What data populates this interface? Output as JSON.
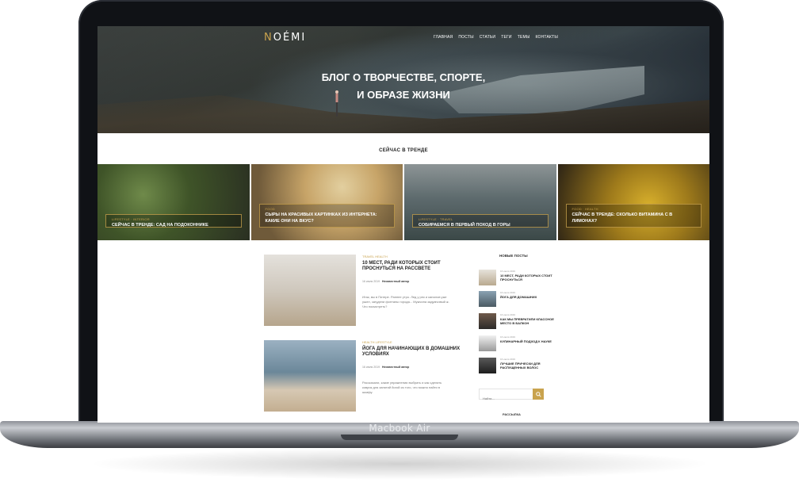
{
  "device": {
    "label": "Macbook Air"
  },
  "site": {
    "logo_accent": "N",
    "logo_rest": "OÉMI",
    "nav": [
      "ГЛАВНАЯ",
      "ПОСТЫ",
      "СТАТЬИ",
      "ТЕГИ",
      "ТЕМЫ",
      "КОНТАКТЫ"
    ],
    "hero_line1": "БЛОГ О ТВОРЧЕСТВЕ, СПОРТЕ,",
    "hero_line2": "И ОБРАЗЕ ЖИЗНИ",
    "accent_color": "#c9a34e"
  },
  "trending": {
    "title": "СЕЙЧАС В ТРЕНДЕ",
    "cards": [
      {
        "tags": "LIFESTYLE · INTERIOR",
        "title": "СЕЙЧАС В ТРЕНДЕ: САД НА ПОДОКОННИКЕ"
      },
      {
        "tags": "FOOD",
        "title": "СЫРЫ НА КРАСИВЫХ КАРТИНКАХ ИЗ ИНТЕРНЕТА: КАКИЕ ОНИ НА ВКУС?"
      },
      {
        "tags": "LIFESTYLE · TRAVEL",
        "title": "СОБИРАЕМСЯ В ПЕРВЫЙ ПОХОД В ГОРЫ"
      },
      {
        "tags": "FOOD · HEALTH",
        "title": "СЕЙЧАС В ТРЕНДЕ: СКОЛЬКО ВИТАМИНА С В ЛИМОНАХ?"
      }
    ]
  },
  "posts": [
    {
      "tags": "TRAVEL     HEALTH",
      "title": "10 МЕСТ, РАДИ КОТОРЫХ СТОИТ ПРОСНУТЬСЯ НА РАССВЕТЕ",
      "date": "16 июля 2019",
      "author": "Неизвестный автор",
      "excerpt": "Итак, вы в Питере. Раннее утро. Лед у рек и каналов уже ушел, загудели фонтаны города... Мужчина задумчивый ж. Что посмотреть?"
    },
    {
      "tags": "HEALTH     LIFESTYLE",
      "title": "ЙОГА ДЛЯ НАЧИНАЮЩИХ В ДОМАШНИХ УСЛОВИЯХ",
      "date": "16 июля 2019",
      "author": "Неизвестный автор",
      "excerpt": "Рассказали, какие упражнения выбрать и как сделать коврик для занятий йогой из того, что можно найти в шкафу."
    }
  ],
  "sidebar": {
    "title": "НОВЫЕ ПОСТЫ",
    "items": [
      {
        "date": "16 июля 2019",
        "title": "10 МЕСТ, РАДИ КОТОРЫХ СТОИТ ПРОСНУТЬСЯ"
      },
      {
        "date": "16 июля 2019",
        "title": "ЙОГА ДЛЯ ДОМАШНИХ"
      },
      {
        "date": "16 июля 2019",
        "title": "КАК МЫ ПРЕВРАТИЛИ КЛАССНОЕ МЕСТО В БАЛКОН"
      },
      {
        "date": "16 июля 2019",
        "title": "КУЛИНАРНЫЙ ПОДХОД К НАУКЕ"
      },
      {
        "date": "16 июля 2019",
        "title": "ЛУЧШИЕ ПРИЧЕСКИ ДЛЯ РАСПУЩЕННЫХ ВОЛОС"
      }
    ],
    "search_placeholder": "Найти...",
    "newsletter": "РАССЫЛКА"
  }
}
